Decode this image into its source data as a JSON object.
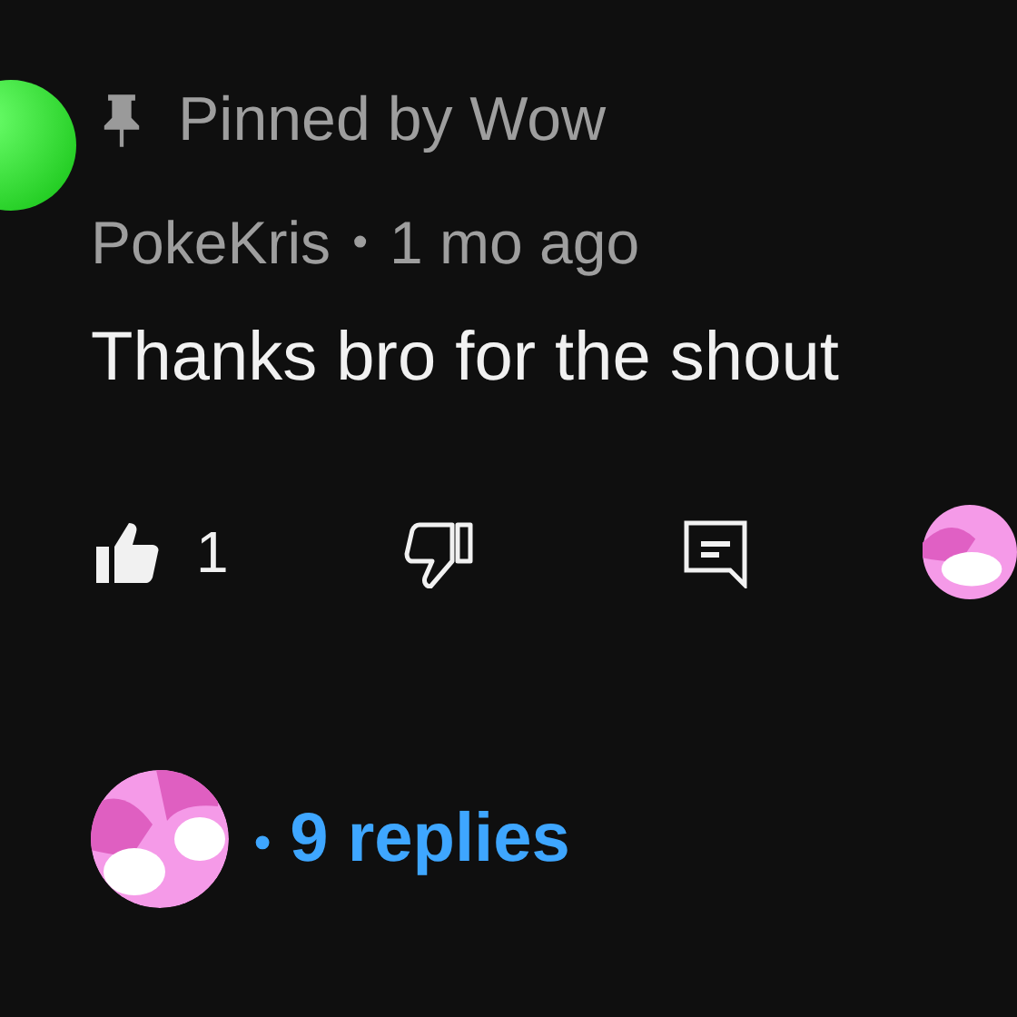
{
  "comment": {
    "pinned_label": "Pinned by Wow",
    "author": "PokeKris",
    "separator": "•",
    "time": "1 mo ago",
    "text": "Thanks bro for the shout",
    "actions": {
      "like": {
        "selected": true,
        "count": "1"
      },
      "dislike": {
        "selected": false
      }
    },
    "replies": {
      "separator": "•",
      "label": "9 replies"
    }
  }
}
